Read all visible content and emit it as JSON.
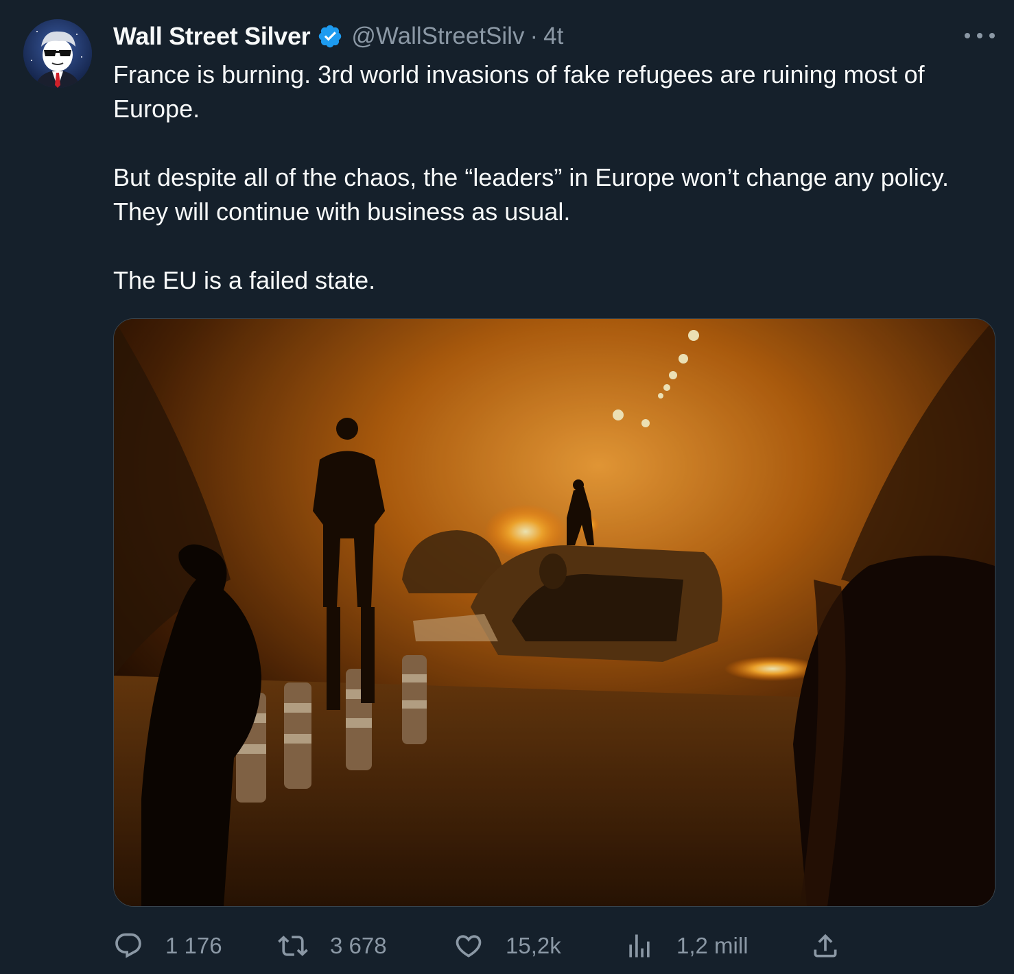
{
  "tweet": {
    "author_name": "Wall Street Silver",
    "handle": "@WallStreetSilv",
    "separator": "·",
    "time": "4t",
    "paragraphs": [
      "France is burning. 3rd world invasions of fake refugees are ruining most of Europe.",
      "But despite all of the chaos, the “leaders” in Europe won’t change any policy. They will continue with business as usual.",
      "The EU is a failed state."
    ]
  },
  "actions": {
    "replies": "1 176",
    "retweets": "3 678",
    "likes": "15,2k",
    "views": "1,2 mill"
  },
  "icons": {
    "verified": "verified-badge-icon",
    "more": "more-options-icon",
    "reply": "reply-icon",
    "retweet": "retweet-icon",
    "like": "heart-icon",
    "views": "analytics-icon",
    "share": "share-icon"
  },
  "colors": {
    "background": "#15202b",
    "text": "#f7f9f9",
    "secondary_text": "#8b98a5",
    "verified": "#1d9bf0",
    "border": "#38444d"
  }
}
